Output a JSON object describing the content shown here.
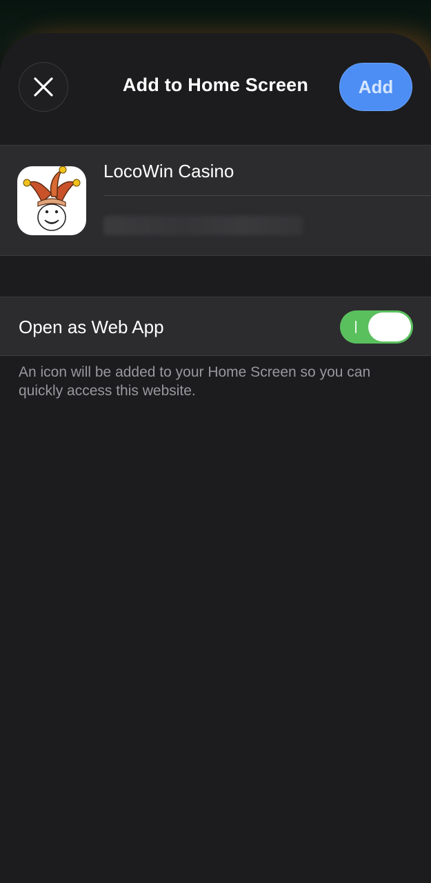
{
  "header": {
    "title": "Add to Home Screen",
    "add_label": "Add",
    "close_icon": "close-icon"
  },
  "app": {
    "name": "LocoWin Casino",
    "icon": "jester-icon"
  },
  "web_app": {
    "label": "Open as Web App",
    "toggle_on": true,
    "toggle_color": "#5ac05e"
  },
  "footnote": "An icon will be added to your Home Screen so you can quickly access this website.",
  "colors": {
    "accent": "#4d8ef5",
    "background": "#1c1c1e",
    "cell": "#2c2c2e"
  }
}
